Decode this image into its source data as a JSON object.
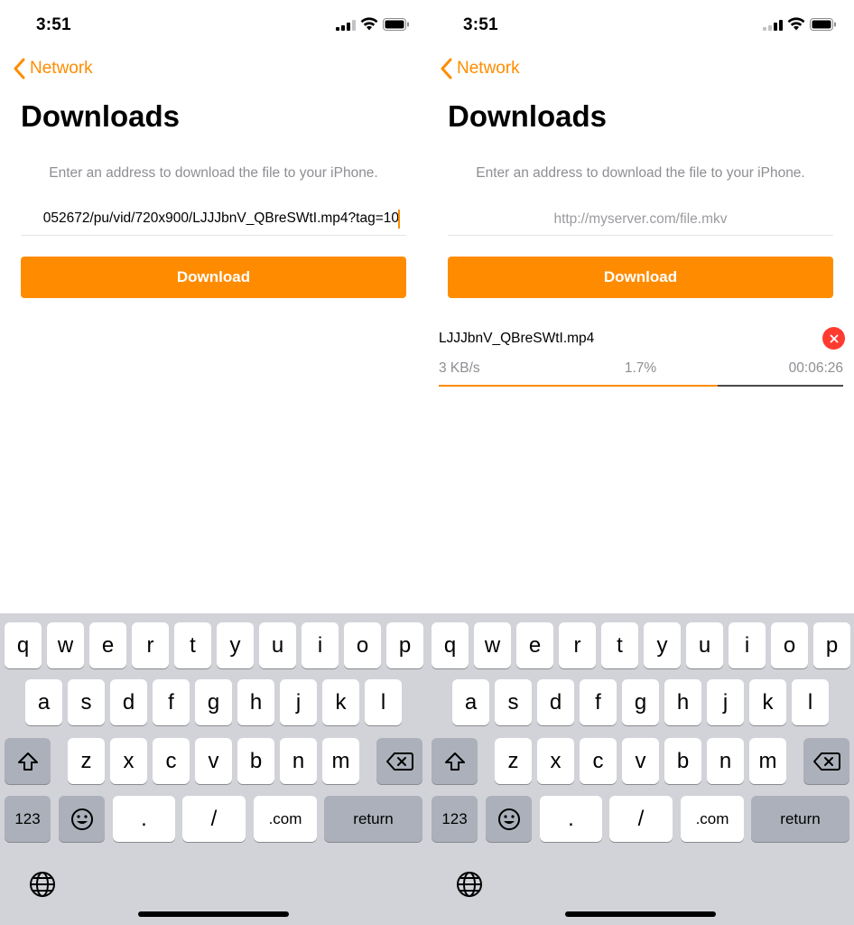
{
  "screens": [
    {
      "status": {
        "time": "3:51"
      },
      "nav": {
        "back_label": "Network"
      },
      "title": "Downloads",
      "hint": "Enter an address to download the file to your iPhone.",
      "url_input": {
        "value": "052672/pu/vid/720x900/LJJJbnV_QBreSWtI.mp4?tag=10",
        "placeholder": ""
      },
      "download_button": "Download",
      "keyboard": {
        "row1": [
          "q",
          "w",
          "e",
          "r",
          "t",
          "y",
          "u",
          "i",
          "o",
          "p"
        ],
        "row2": [
          "a",
          "s",
          "d",
          "f",
          "g",
          "h",
          "j",
          "k",
          "l"
        ],
        "row3": [
          "z",
          "x",
          "c",
          "v",
          "b",
          "n",
          "m"
        ],
        "numbers_key": "123",
        "period_key": ".",
        "slash_key": "/",
        "dotcom_key": ".com",
        "return_key": "return"
      }
    },
    {
      "status": {
        "time": "3:51"
      },
      "nav": {
        "back_label": "Network"
      },
      "title": "Downloads",
      "hint": "Enter an address to download the file to your iPhone.",
      "url_input": {
        "value": "",
        "placeholder": "http://myserver.com/file.mkv"
      },
      "download_button": "Download",
      "download_item": {
        "filename": "LJJJbnV_QBreSWtI.mp4",
        "speed": "3 KB/s",
        "percent": "1.7%",
        "time_remaining": "00:06:26",
        "progress_fraction": 0.69
      },
      "keyboard": {
        "row1": [
          "q",
          "w",
          "e",
          "r",
          "t",
          "y",
          "u",
          "i",
          "o",
          "p"
        ],
        "row2": [
          "a",
          "s",
          "d",
          "f",
          "g",
          "h",
          "j",
          "k",
          "l"
        ],
        "row3": [
          "z",
          "x",
          "c",
          "v",
          "b",
          "n",
          "m"
        ],
        "numbers_key": "123",
        "period_key": ".",
        "slash_key": "/",
        "dotcom_key": ".com",
        "return_key": "return"
      }
    }
  ],
  "colors": {
    "accent": "#ff8c00",
    "cancel": "#ff3b30",
    "keyboard_bg": "#d1d3d9"
  }
}
